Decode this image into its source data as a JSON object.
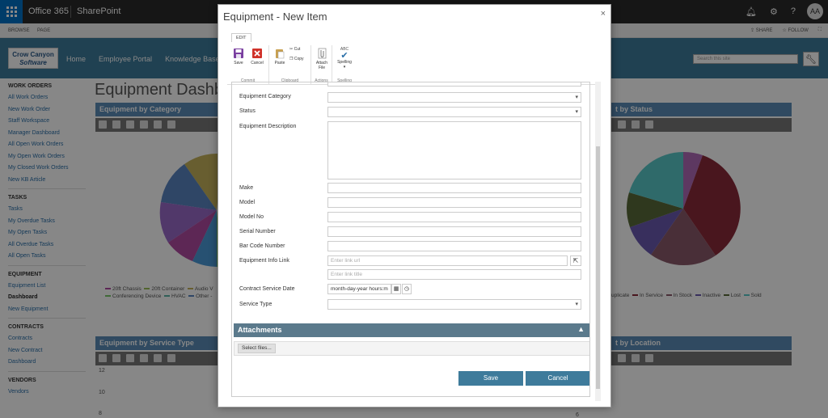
{
  "suite": {
    "app": "Office 365",
    "product": "SharePoint",
    "user_initials": "AA"
  },
  "ribbon_tabs": {
    "browse": "BROWSE",
    "page": "PAGE",
    "share": "SHARE",
    "follow": "FOLLOW"
  },
  "site": {
    "logo_line1": "Crow Canyon",
    "logo_line2": "Software",
    "nav": [
      "Home",
      "Employee Portal",
      "Knowledge Base"
    ],
    "search_placeholder": "Search this site"
  },
  "leftnav": {
    "groups": [
      {
        "title": "WORK ORDERS",
        "items": [
          "All Work Orders",
          "New Work Order",
          "Staff Workspace",
          "Manager Dashboard",
          "All Open Work Orders",
          "My Open Work Orders",
          "My Closed Work Orders",
          "New KB Article"
        ]
      },
      {
        "title": "TASKS",
        "items": [
          "Tasks",
          "My Overdue Tasks",
          "My Open Tasks",
          "All Overdue Tasks",
          "All Open Tasks"
        ]
      },
      {
        "title": "EQUIPMENT",
        "items": [
          "Equipment List",
          "Dashboard",
          "New Equipment"
        ]
      },
      {
        "title": "CONTRACTS",
        "items": [
          "Contracts",
          "New Contract",
          "Dashboard"
        ]
      },
      {
        "title": "VENDORS",
        "items": [
          "Vendors"
        ]
      }
    ],
    "current": "Dashboard"
  },
  "page": {
    "title": "Equipment Dashbo"
  },
  "webparts": {
    "by_category": "Equipment by Category",
    "by_status": "t by Status",
    "by_service_type": "Equipment by Service Type",
    "by_location": "t by Location"
  },
  "legend_category": {
    "row1": [
      "20ft Chassis",
      "20ft Container",
      "Audio V"
    ],
    "row2": [
      "Conferencing Device",
      "HVAC",
      "Other -"
    ],
    "colors1": [
      "#b04aa0",
      "#9cbf5a",
      "#c4b25c"
    ],
    "colors2": [
      "#7ac96a",
      "#5bb3a6",
      "#5a84c0"
    ]
  },
  "legend_status": {
    "items": [
      "uplicate",
      "In Service",
      "In Stock",
      "Inactive",
      "Lost",
      "Sold"
    ],
    "colors": [
      "#a0a0a0",
      "#8b2a3a",
      "#8b5a6a",
      "#6a5ab0",
      "#5a6a3a",
      "#5ac8c8"
    ]
  },
  "service_axis": [
    "12",
    "10",
    "8"
  ],
  "location_axis": [
    "6"
  ],
  "dialog": {
    "title": "Equipment - New Item",
    "close": "×",
    "ribbon_tab": "EDIT",
    "buttons": {
      "save": "Save",
      "cancel": "Cancel",
      "paste": "Paste",
      "cut": "Cut",
      "copy": "Copy",
      "attach_file_1": "Attach",
      "attach_file_2": "File",
      "spelling_abc": "ABC",
      "spelling": "Spelling"
    },
    "groups": {
      "commit": "Commit",
      "clipboard": "Clipboard",
      "actions": "Actions",
      "spelling": "Spelling"
    },
    "fields": {
      "equipment_category": "Equipment Category",
      "status": "Status",
      "equipment_description": "Equipment Description",
      "make": "Make",
      "model": "Model",
      "model_no": "Model No",
      "serial_number": "Serial Number",
      "bar_code_number": "Bar Code Number",
      "equipment_info_link": "Equipment Info Link",
      "link_url_placeholder": "Enter link url",
      "link_title_placeholder": "Enter link title",
      "contract_service_date": "Contract Service Date",
      "date_placeholder": "month-day-year hours:m",
      "service_type": "Service Type"
    },
    "attachments": "Attachments",
    "select_files": "Select files...",
    "save_btn": "Save",
    "cancel_btn": "Cancel"
  }
}
